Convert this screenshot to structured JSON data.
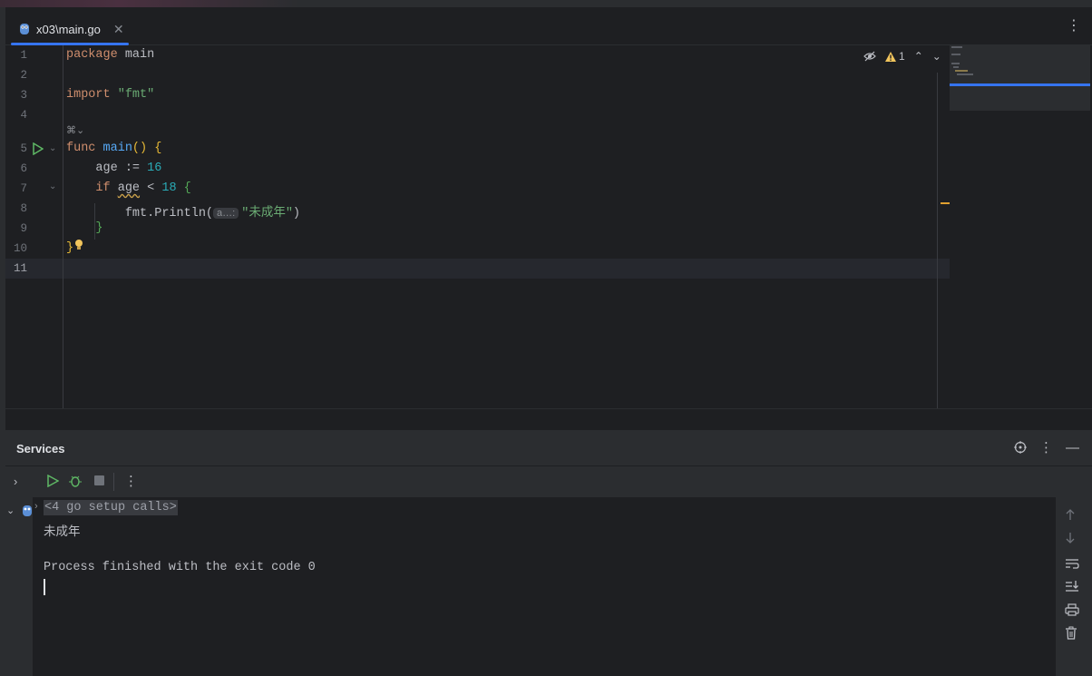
{
  "tab": {
    "label": "x03\\main.go"
  },
  "editor": {
    "line_numbers": [
      "1",
      "2",
      "3",
      "4",
      "5",
      "6",
      "7",
      "8",
      "9",
      "10",
      "11"
    ],
    "code": {
      "l1_kw": "package",
      "l1_rest": " main",
      "l3_kw": "import",
      "l3_str": "\"fmt\"",
      "l5_kw": "func",
      "l5_fn": "main",
      "l5_rest": "() ",
      "l6_ident": "age",
      "l6_op": " := ",
      "l6_num": "16",
      "l7_kw": "if",
      "l7_ident": "age",
      "l7_op": " < ",
      "l7_num": "18",
      "l8_call": "fmt.Println(",
      "l8_hint": "a…:",
      "l8_str": "\"未成年\"",
      "l8_close": ")"
    },
    "warning_count": "1"
  },
  "services": {
    "title": "Services",
    "console": {
      "setup_calls": "<4 go setup calls>",
      "output": "未成年",
      "finished": "Process finished with the exit code 0"
    }
  }
}
